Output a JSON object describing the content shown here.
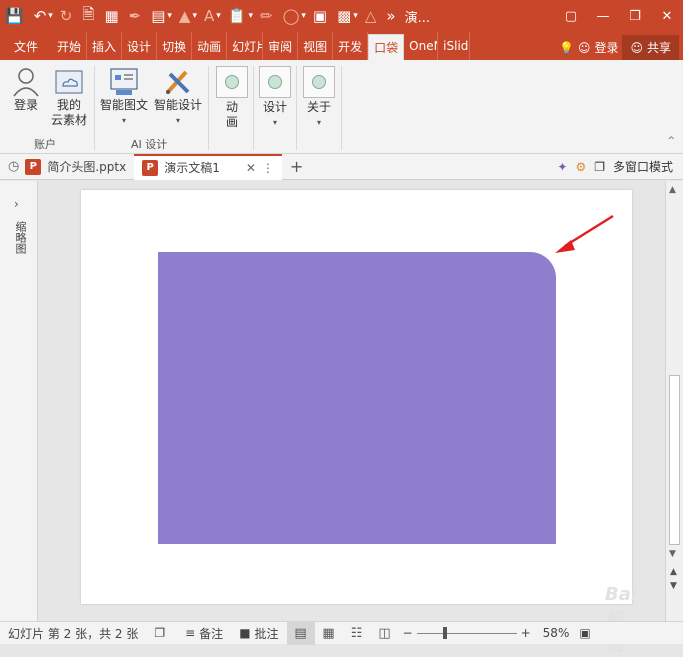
{
  "qat": {
    "title": "演..."
  },
  "tabs": {
    "file": "文件",
    "items": [
      "开始",
      "插入",
      "设计",
      "切换",
      "动画",
      "幻灯片",
      "审阅",
      "视图",
      "开发",
      "口袋",
      "OneN",
      "iSlide"
    ],
    "active_index": 9,
    "login": "登录",
    "share": "共享"
  },
  "ribbon": {
    "login": "登录",
    "cloud_line1": "我的",
    "cloud_line2": "云素材",
    "group_account": "账户",
    "smart_chart": "智能图文",
    "smart_design": "智能设计",
    "group_ai": "AI 设计",
    "anim_line1": "动",
    "anim_line2": "画",
    "design": "设计",
    "about": "关于"
  },
  "doctabs": {
    "tab1": "简介头图.pptx",
    "tab2": "演示文稿1",
    "multiwin": "多窗口模式"
  },
  "leftpanel": {
    "label": "缩略图"
  },
  "watermark": "Bai 经验",
  "status": {
    "slide_info": "幻灯片 第 2 张，共 2 张",
    "notes": "备注",
    "comments": "批注",
    "zoom": "58%"
  }
}
